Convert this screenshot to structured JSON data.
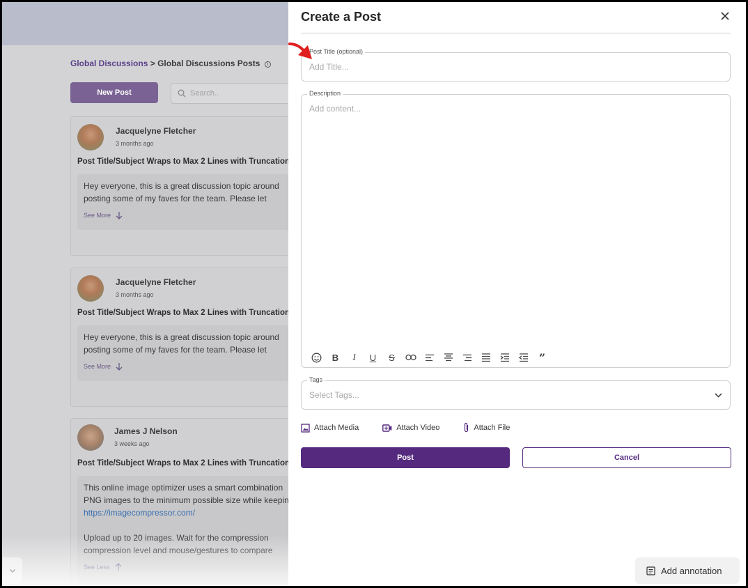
{
  "background": {
    "breadcrumb": {
      "root": "Global Discussions",
      "separator": ">",
      "current": "Global Discussions Posts",
      "info_glyph": "i"
    },
    "new_post_label": "New Post",
    "search_placeholder": "Search..",
    "posts": [
      {
        "author": "Jacquelyne Fletcher",
        "time": "3 months ago",
        "title": "Post Title/Subject Wraps to Max 2 Lines with Truncation",
        "lines": [
          "Hey everyone, this is a great discussion topic around",
          "posting some of my faves for the team. Please let"
        ],
        "toggle": "See More"
      },
      {
        "author": "Jacquelyne Fletcher",
        "time": "3 months ago",
        "title": "Post Title/Subject Wraps to Max 2 Lines with Truncation",
        "lines": [
          "Hey everyone, this is a great discussion topic around",
          "posting some of my faves for the team. Please let"
        ],
        "toggle": "See More"
      },
      {
        "author": "James J Nelson",
        "time": "3 weeks ago",
        "title": "Post Title/Subject Wraps to Max 2 Lines with Truncation",
        "lines": [
          "This online image optimizer uses a smart combination",
          "PNG images to the minimum possible size while keeping",
          "https://imagecompressor.com/",
          "",
          "Upload up to 20 images. Wait for the compression",
          "compression level and mouse/gestures to compare"
        ],
        "toggle": "See Less"
      }
    ]
  },
  "modal": {
    "title": "Create a Post",
    "post_title_label": "Post Title (optional)",
    "post_title_placeholder": "Add Title...",
    "description_label": "Description",
    "description_placeholder": "Add content...",
    "toolbar": [
      {
        "name": "emoji-icon"
      },
      {
        "name": "bold-icon",
        "glyph": "B"
      },
      {
        "name": "italic-icon",
        "glyph": "I"
      },
      {
        "name": "underline-icon",
        "glyph": "U"
      },
      {
        "name": "strikethrough-icon",
        "glyph": "S"
      },
      {
        "name": "link-icon"
      },
      {
        "name": "align-left-icon"
      },
      {
        "name": "align-center-icon"
      },
      {
        "name": "align-right-icon"
      },
      {
        "name": "align-justify-icon"
      },
      {
        "name": "indent-icon"
      },
      {
        "name": "outdent-icon"
      },
      {
        "name": "quote-icon",
        "glyph": "”"
      }
    ],
    "tags_label": "Tags",
    "tags_placeholder": "Select Tags...",
    "attach_media": "Attach Media",
    "attach_video": "Attach Video",
    "attach_file": "Attach File",
    "post_label": "Post",
    "cancel_label": "Cancel"
  },
  "add_annotation_label": "Add annotation",
  "colors": {
    "primary": "#552a7e",
    "arrow": "#e01e1e"
  }
}
